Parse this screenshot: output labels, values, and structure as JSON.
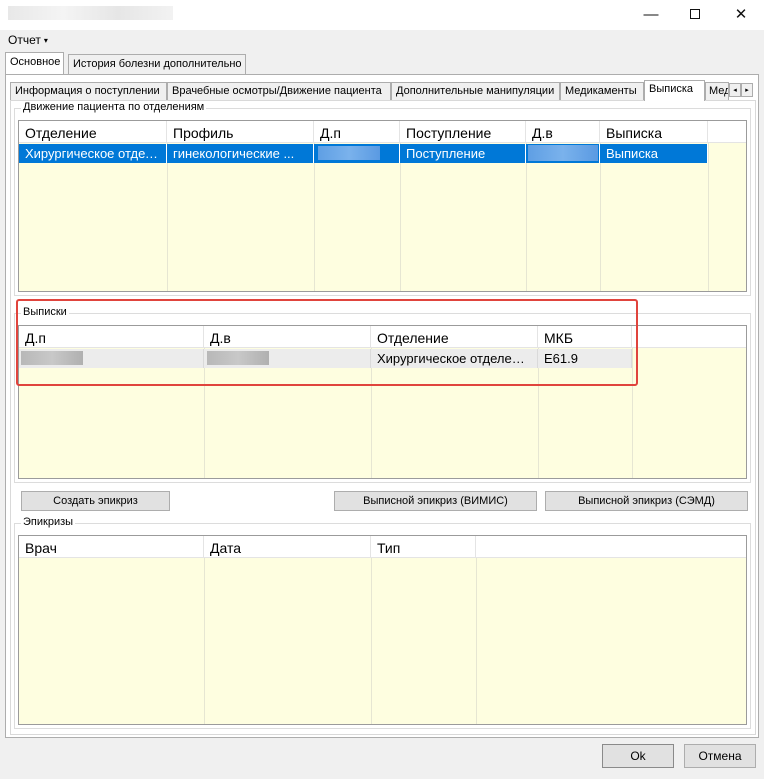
{
  "window": {
    "minimize_glyph": "—",
    "close_glyph": "✕"
  },
  "menu": {
    "report_label": "Отчет",
    "caret": "▾"
  },
  "tabs_main": [
    {
      "label": "Основное",
      "active": true
    },
    {
      "label": "История болезни дополнительно",
      "active": false
    }
  ],
  "tabs_sub": [
    {
      "label": "Информация о поступлении"
    },
    {
      "label": "Врачебные осмотры/Движение пациента"
    },
    {
      "label": "Дополнительные манипуляции"
    },
    {
      "label": "Медикаменты"
    },
    {
      "label": "Выписка",
      "active": true
    },
    {
      "label": "Мед"
    }
  ],
  "tab_scroll": {
    "left": "◂",
    "right": "▸"
  },
  "movement": {
    "group_label": "Движение пациента по отделениям",
    "columns": [
      "Отделение",
      "Профиль",
      "Д.п",
      "Поступление",
      "Д.в",
      "Выписка"
    ],
    "rows": [
      {
        "department": "Хирургическое отделение",
        "profile": "гинекологические ...",
        "dp": "",
        "admission": "Поступление",
        "dv": "",
        "discharge": "Выписка",
        "selected": true
      }
    ]
  },
  "discharges": {
    "group_label": "Выписки",
    "columns": [
      "Д.п",
      "Д.в",
      "Отделение",
      "МКБ"
    ],
    "rows": [
      {
        "dp": "",
        "dv": "",
        "department": "Хирургическое отделение",
        "icd": "E61.9"
      }
    ]
  },
  "buttons": {
    "create_epicrisis": "Создать эпикриз",
    "vimis": "Выписной эпикриз (ВИМИС)",
    "semd": "Выписной эпикриз (СЭМД)",
    "ok": "Ok",
    "cancel": "Отмена"
  },
  "epicrises": {
    "group_label": "Эпикризы",
    "columns": [
      "Врач",
      "Дата",
      "Тип"
    ]
  }
}
